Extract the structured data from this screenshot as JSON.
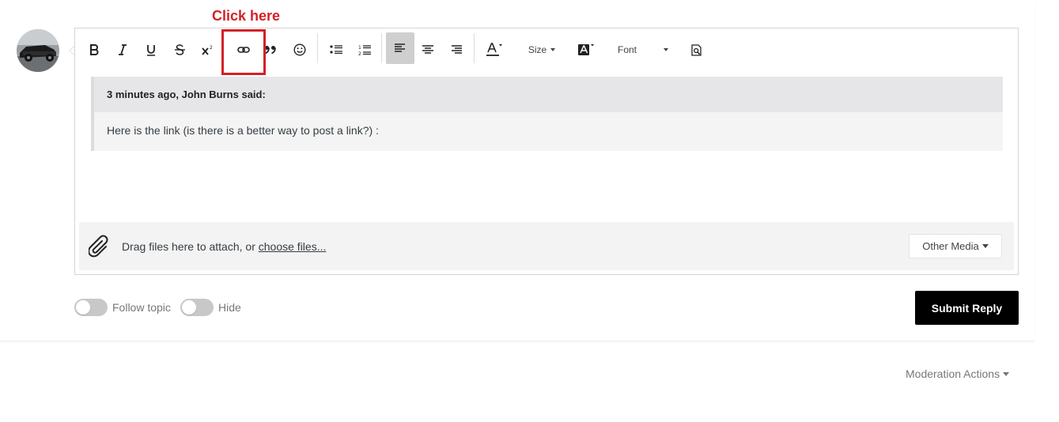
{
  "annotation": {
    "text": "Click here",
    "color": "#d42027"
  },
  "avatar": {
    "alt": "user avatar"
  },
  "toolbar": {
    "buttons": [
      {
        "name": "bold",
        "icon": "bold-icon"
      },
      {
        "name": "italic",
        "icon": "italic-icon"
      },
      {
        "name": "underline",
        "icon": "underline-icon"
      },
      {
        "name": "strikethrough",
        "icon": "strikethrough-icon"
      },
      {
        "name": "superscript",
        "icon": "superscript-icon"
      },
      {
        "name": "link",
        "icon": "link-icon"
      },
      {
        "name": "quote",
        "icon": "quote-icon"
      },
      {
        "name": "emoji",
        "icon": "smiley-icon"
      },
      {
        "name": "bulleted-list",
        "icon": "bulleted-list-icon"
      },
      {
        "name": "numbered-list",
        "icon": "numbered-list-icon"
      },
      {
        "name": "align-left",
        "icon": "align-left-icon",
        "active": true
      },
      {
        "name": "align-center",
        "icon": "align-center-icon"
      },
      {
        "name": "align-right",
        "icon": "align-right-icon"
      },
      {
        "name": "text-color",
        "icon": "text-color-icon"
      },
      {
        "name": "background-color",
        "icon": "background-color-icon"
      },
      {
        "name": "preview",
        "icon": "preview-icon"
      }
    ],
    "size_label": "Size",
    "font_label": "Font"
  },
  "quote": {
    "header": "3 minutes ago, John Burns said:",
    "body": "Here is the link (is there is a better way to post a link?) :"
  },
  "attach": {
    "prompt": "Drag files here to attach, or ",
    "link": "choose files...",
    "other_media": "Other Media"
  },
  "options": {
    "follow_topic": "Follow topic",
    "hide": "Hide"
  },
  "submit": "Submit Reply",
  "moderation": "Moderation Actions",
  "colors": {
    "accent": "#000000",
    "annotation": "#d42027",
    "active_button": "#cfcfcf"
  }
}
